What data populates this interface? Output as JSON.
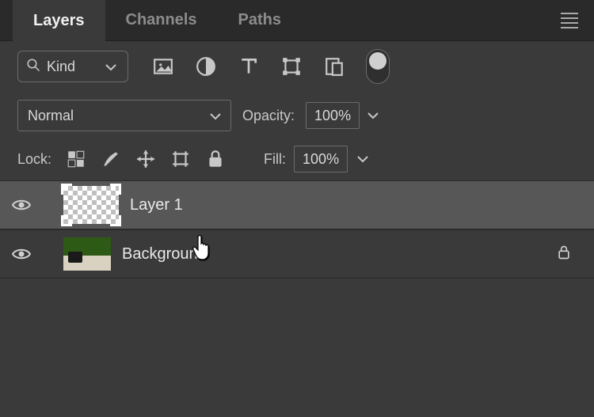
{
  "tabs": {
    "layers": "Layers",
    "channels": "Channels",
    "paths": "Paths"
  },
  "filter": {
    "kind": "Kind"
  },
  "blend": {
    "mode": "Normal",
    "opacity_label": "Opacity:",
    "opacity_value": "100%"
  },
  "lock": {
    "label": "Lock:",
    "fill_label": "Fill:",
    "fill_value": "100%"
  },
  "layers_list": [
    {
      "name": "Layer 1",
      "locked": false
    },
    {
      "name": "Background",
      "locked": true
    }
  ]
}
